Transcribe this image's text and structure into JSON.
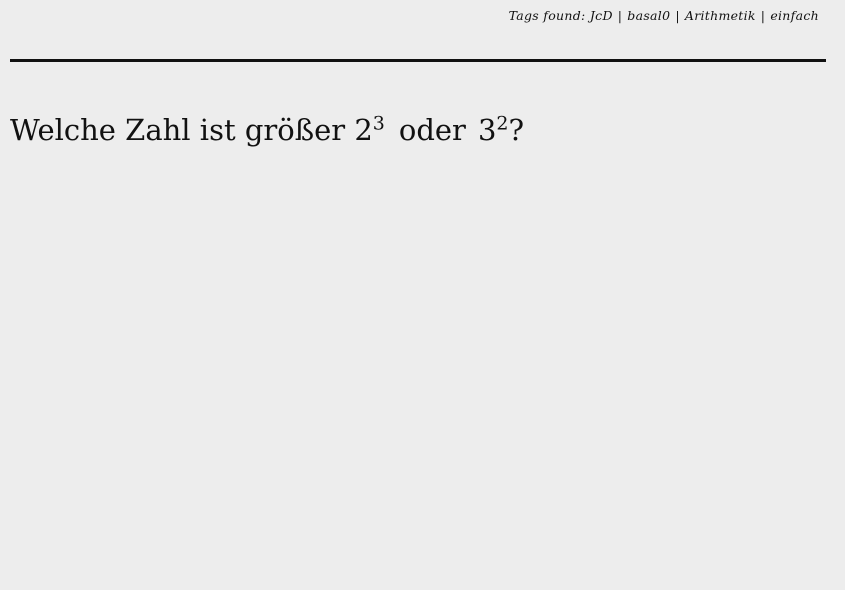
{
  "header": {
    "tags_prefix": "Tags found:",
    "tags": [
      "JcD",
      "basal0",
      "Arithmetik",
      "einfach"
    ],
    "separator": "|"
  },
  "question": {
    "lead_text": "Welche Zahl ist größer",
    "term1_base": "2",
    "term1_exponent": "3",
    "connector": "oder",
    "term2_base": "3",
    "term2_exponent": "2",
    "end_punct": "?"
  }
}
